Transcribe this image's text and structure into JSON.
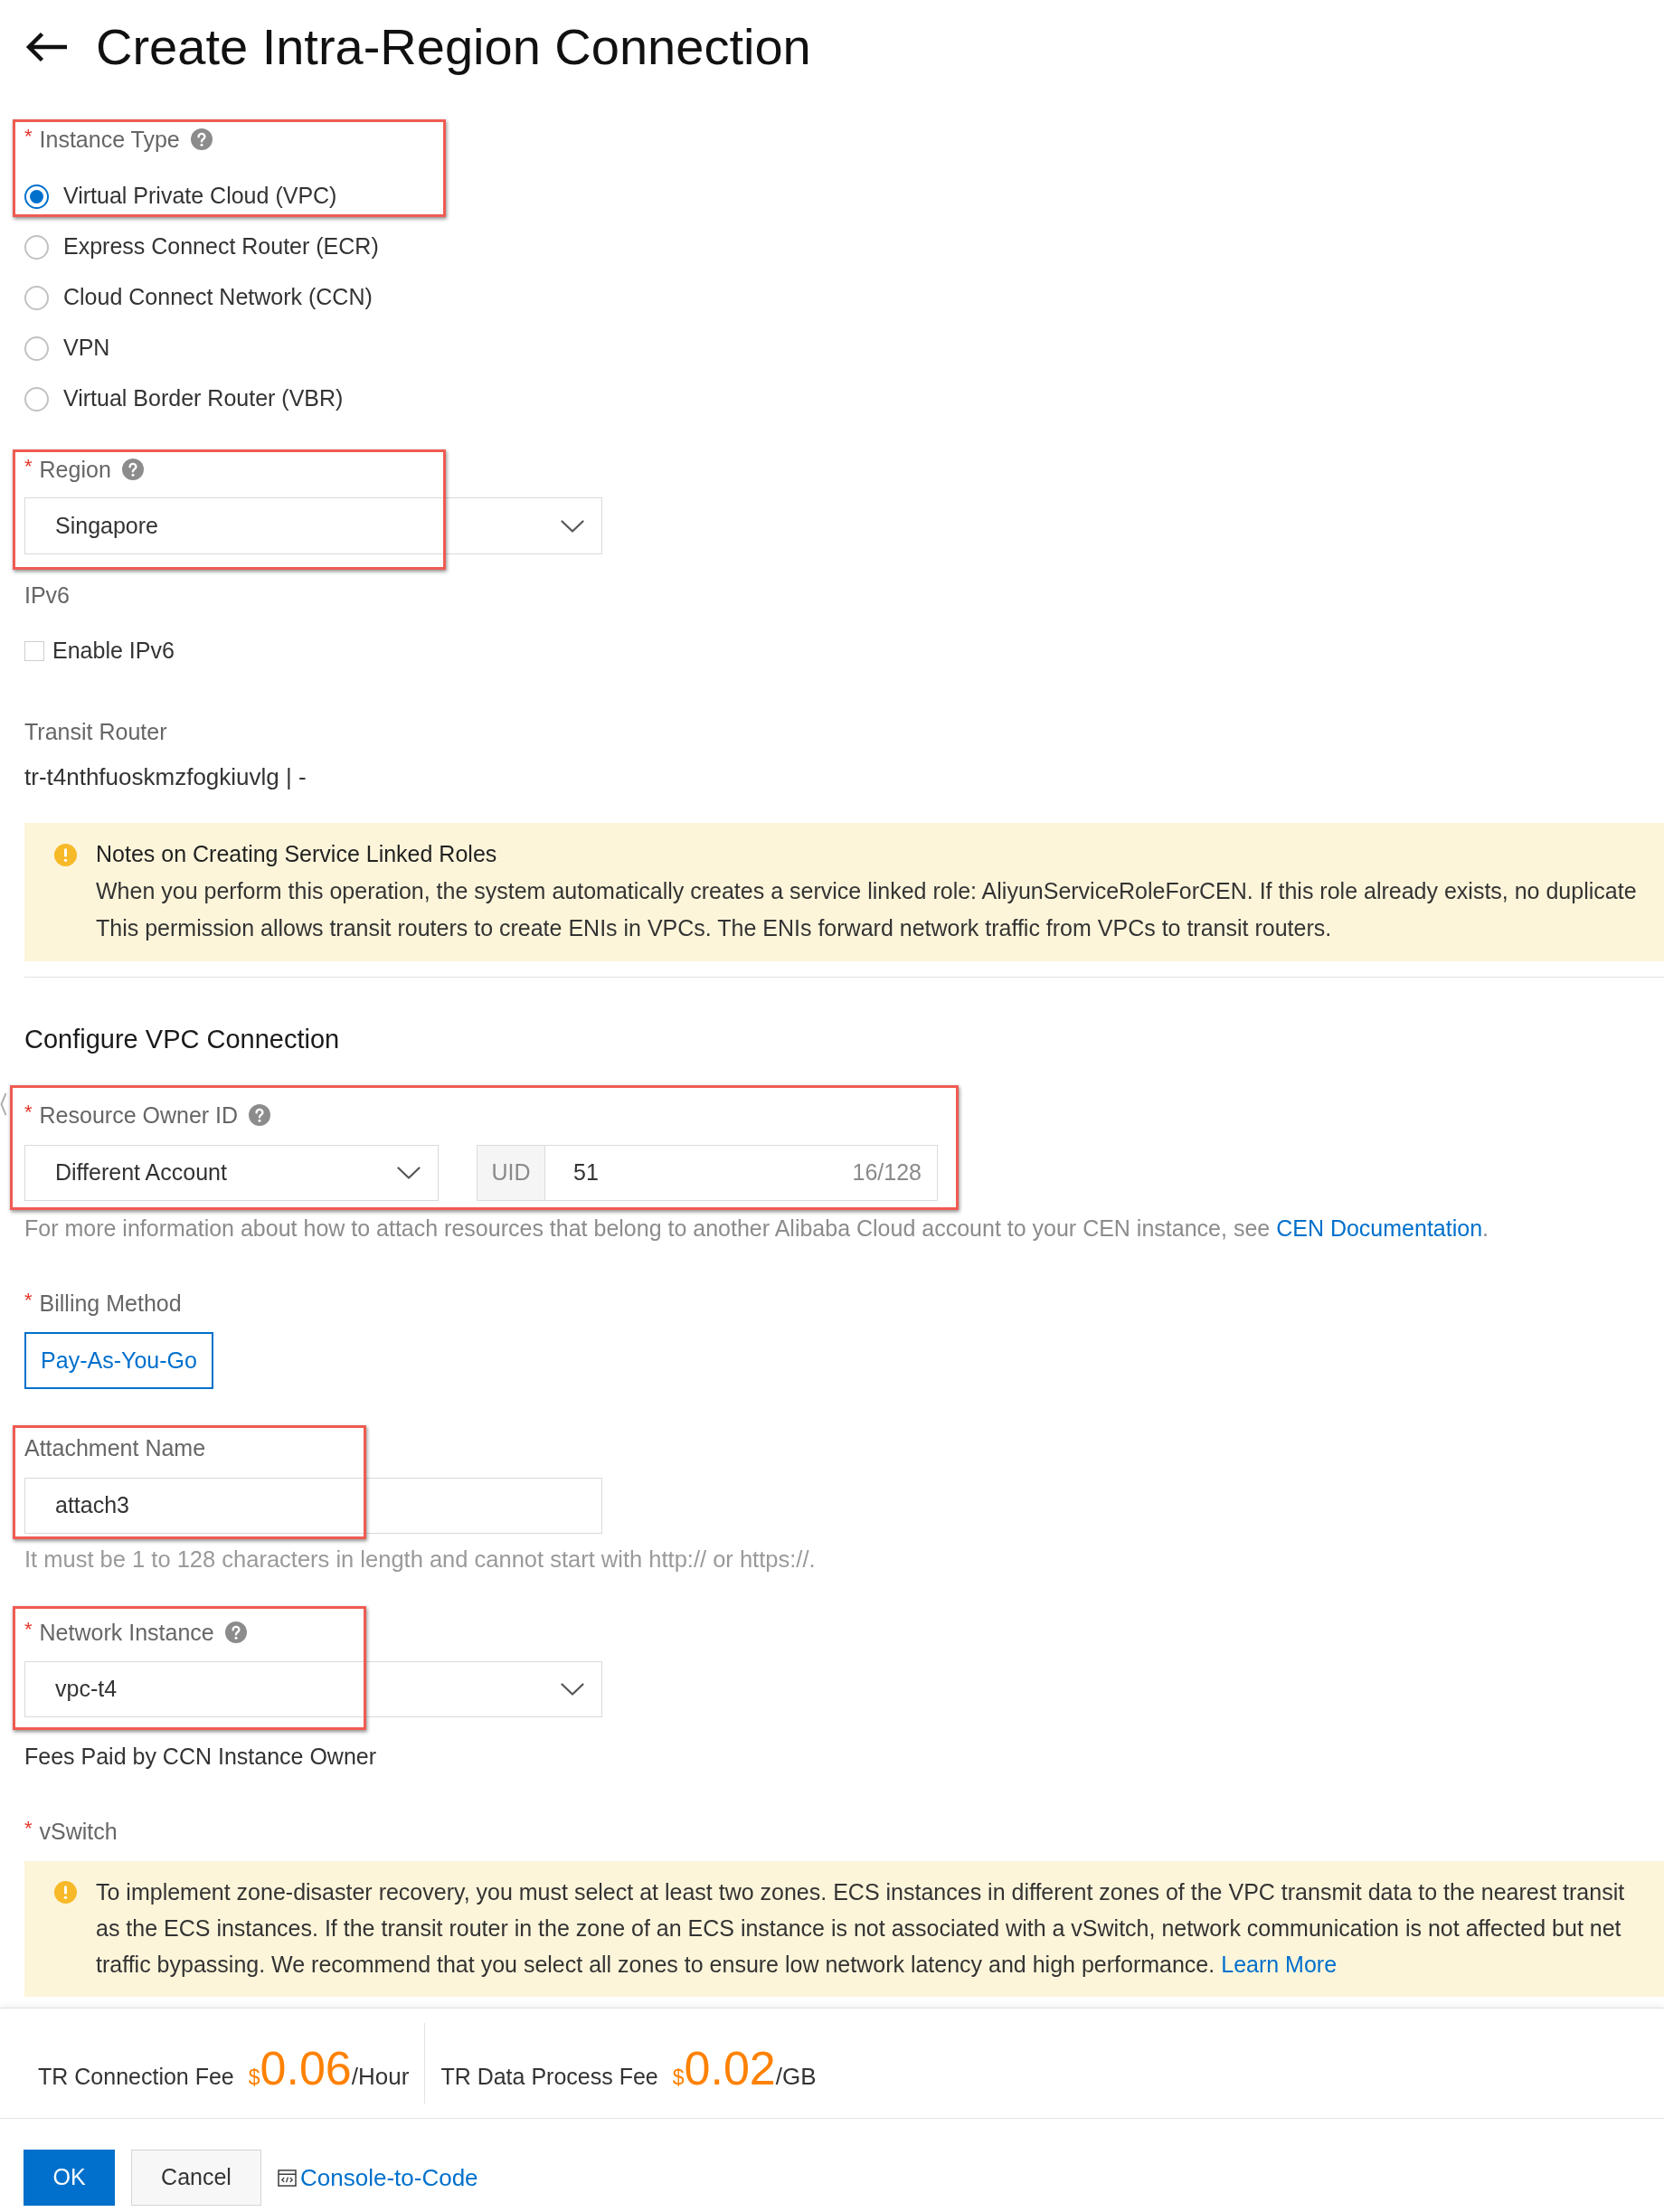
{
  "header": {
    "title": "Create Intra-Region Connection"
  },
  "instance_type": {
    "label": "Instance Type",
    "required_mark": "*",
    "help": true,
    "highlighted": true,
    "options": [
      {
        "label": "Virtual Private Cloud (VPC)",
        "selected": true
      },
      {
        "label": "Express Connect Router (ECR)",
        "selected": false
      },
      {
        "label": "Cloud Connect Network (CCN)",
        "selected": false
      },
      {
        "label": "VPN",
        "selected": false
      },
      {
        "label": "Virtual Border Router (VBR)",
        "selected": false
      }
    ]
  },
  "region": {
    "label": "Region",
    "required_mark": "*",
    "help": true,
    "highlighted": true,
    "value": "Singapore"
  },
  "ipv6": {
    "label": "IPv6",
    "checkbox": {
      "label": "Enable IPv6",
      "checked": false
    }
  },
  "transit_router": {
    "label": "Transit Router",
    "value": "tr-t4nthfuoskmzfogkiuvlg | -"
  },
  "service_role_notice": {
    "title": "Notes on Creating Service Linked Roles",
    "lines": [
      "When you perform this operation, the system automatically creates a service linked role: AliyunServiceRoleForCEN. If this role already exists, no duplicate",
      "This permission allows transit routers to create ENIs in VPCs. The ENIs forward network traffic from VPCs to transit routers."
    ]
  },
  "vpc_connection": {
    "title": "Configure VPC Connection",
    "resource_owner": {
      "label": "Resource Owner ID",
      "required_mark": "*",
      "help": true,
      "highlighted": true,
      "account_type": "Different Account",
      "uid_label": "UID",
      "uid_value": "51",
      "counter": "16/128",
      "hint": "For more information about how to attach resources that belong to another Alibaba Cloud account to your CEN instance, see",
      "hint_link": "CEN Documentation",
      "hint_end": "."
    },
    "billing_method": {
      "label": "Billing Method",
      "required_mark": "*",
      "options": [
        {
          "label": "Pay-As-You-Go",
          "selected": true
        }
      ]
    },
    "attachment_name": {
      "label": "Attachment Name",
      "highlighted": true,
      "value": "attach3",
      "hint": "It must be 1 to 128 characters in length and cannot start with http:// or https://."
    },
    "network_instance": {
      "label": "Network Instance",
      "required_mark": "*",
      "help": true,
      "highlighted": true,
      "value": "vpc-t4",
      "note": "Fees Paid by CCN Instance Owner"
    },
    "vswitch": {
      "label": "vSwitch",
      "required_mark": "*",
      "notice": {
        "lines": [
          "To implement zone-disaster recovery, you must select at least two zones. ECS instances in different zones of the VPC transmit data to the nearest transit",
          "as the ECS instances. If the transit router in the zone of an ECS instance is not associated with a vSwitch, network communication is not affected but net",
          "traffic bypassing. We recommend that you select all zones to ensure low network latency and high performance."
        ],
        "link": "Learn More"
      }
    }
  },
  "footer": {
    "fees": [
      {
        "label": "TR Connection Fee",
        "currency": "$",
        "amount": "0.06",
        "unit": "/Hour"
      },
      {
        "label": "TR Data Process Fee",
        "currency": "$",
        "amount": "0.02",
        "unit": "/GB"
      }
    ],
    "buttons": [
      {
        "label": "OK",
        "kind": "primary"
      },
      {
        "label": "Cancel",
        "kind": "secondary"
      },
      {
        "label": "Console-to-Code",
        "kind": "link"
      }
    ]
  }
}
